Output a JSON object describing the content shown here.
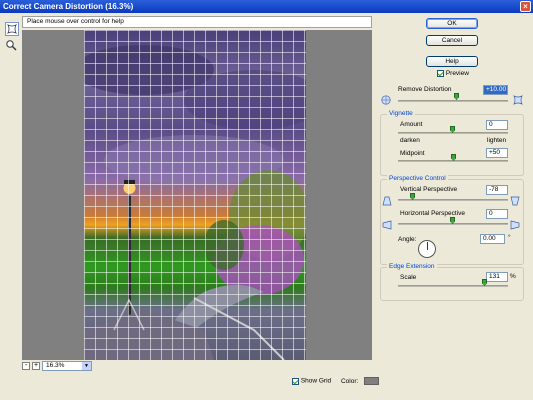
{
  "window": {
    "title": "Correct Camera Distortion (16.3%)"
  },
  "help_text": "Place mouse over control for help",
  "buttons": {
    "ok": "OK",
    "cancel": "Cancel",
    "help": "Help"
  },
  "preview": {
    "label": "Preview",
    "checked": true
  },
  "remove_distortion": {
    "label": "Remove Distortion",
    "value": "+10.00"
  },
  "vignette": {
    "title": "Vignette",
    "amount_label": "Amount",
    "amount_value": "0",
    "darken_label": "darken",
    "lighten_label": "lighten",
    "midpoint_label": "Midpoint",
    "midpoint_value": "+50"
  },
  "perspective": {
    "title": "Perspective Control",
    "vertical_label": "Vertical Perspective",
    "vertical_value": "-78",
    "horizontal_label": "Horizontal Perspective",
    "horizontal_value": "0",
    "angle_label": "Angle:",
    "angle_value": "0.00",
    "angle_unit": "°"
  },
  "edge_extension": {
    "title": "Edge Extension",
    "scale_label": "Scale",
    "scale_value": "131",
    "scale_unit": "%"
  },
  "zoom": {
    "level": "16.3%",
    "minus": "-",
    "plus": "+"
  },
  "grid": {
    "show_label": "Show Grid",
    "checked": true,
    "color_label": "Color:",
    "color": "#808080"
  },
  "colors": {
    "accent": "#0046d5",
    "title_bar": "#0a3ac0"
  },
  "icons": [
    "distort-tool-icon",
    "zoom-tool-icon",
    "barrel-icon",
    "pincushion-icon",
    "perspective-up-icon",
    "perspective-down-icon",
    "perspective-left-icon",
    "perspective-right-icon"
  ]
}
